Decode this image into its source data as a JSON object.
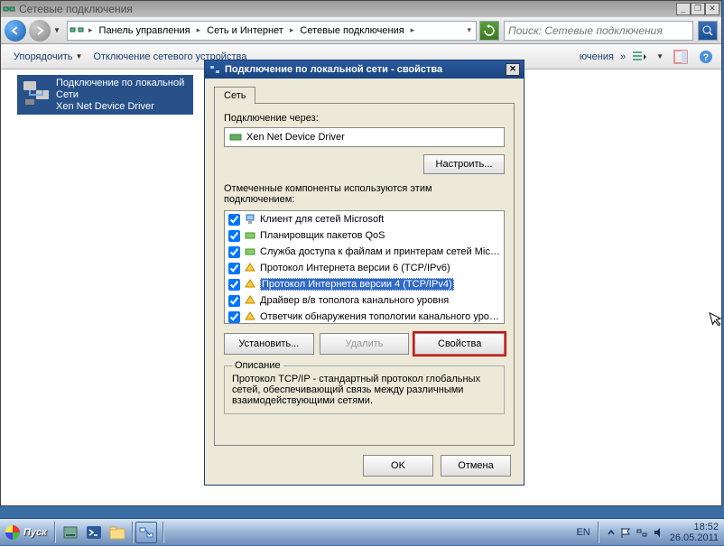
{
  "window": {
    "title": "Сетевые подключения"
  },
  "breadcrumb": {
    "root": "Панель управления",
    "seg1": "Сеть и Интернет",
    "seg2": "Сетевые подключения"
  },
  "search": {
    "placeholder": "Поиск: Сетевые подключения"
  },
  "toolbar": {
    "organize": "Упорядочить",
    "disable": "Отключение сетевого устройства",
    "truncated": "ючения"
  },
  "connection": {
    "line1": "Подключение по локальной",
    "line2": "Сети",
    "line3": "Xen Net Device Driver"
  },
  "dialog": {
    "title": "Подключение по локальной сети - свойства",
    "tab_network": "Сеть",
    "connect_via_label": "Подключение через:",
    "adapter": "Xen Net Device Driver",
    "configure": "Настроить...",
    "components_label": "Отмеченные компоненты используются этим подключением:",
    "components": [
      "Клиент для сетей Microsoft",
      "Планировщик пакетов QoS",
      "Служба доступа к файлам и принтерам сетей Micro...",
      "Протокол Интернета версии 6 (TCP/IPv6)",
      "Протокол Интернета версии 4 (TCP/IPv4)",
      "Драйвер в/в тополога канального уровня",
      "Ответчик обнаружения топологии канального уровня"
    ],
    "install": "Установить...",
    "remove": "Удалить",
    "properties": "Свойства",
    "desc_legend": "Описание",
    "desc_text": "Протокол TCP/IP - стандартный протокол глобальных сетей, обеспечивающий связь между различными взаимодействующими сетями.",
    "ok": "OK",
    "cancel": "Отмена"
  },
  "taskbar": {
    "start": "Пуск",
    "lang": "EN",
    "time": "18:52",
    "date": "26.05.2011"
  }
}
